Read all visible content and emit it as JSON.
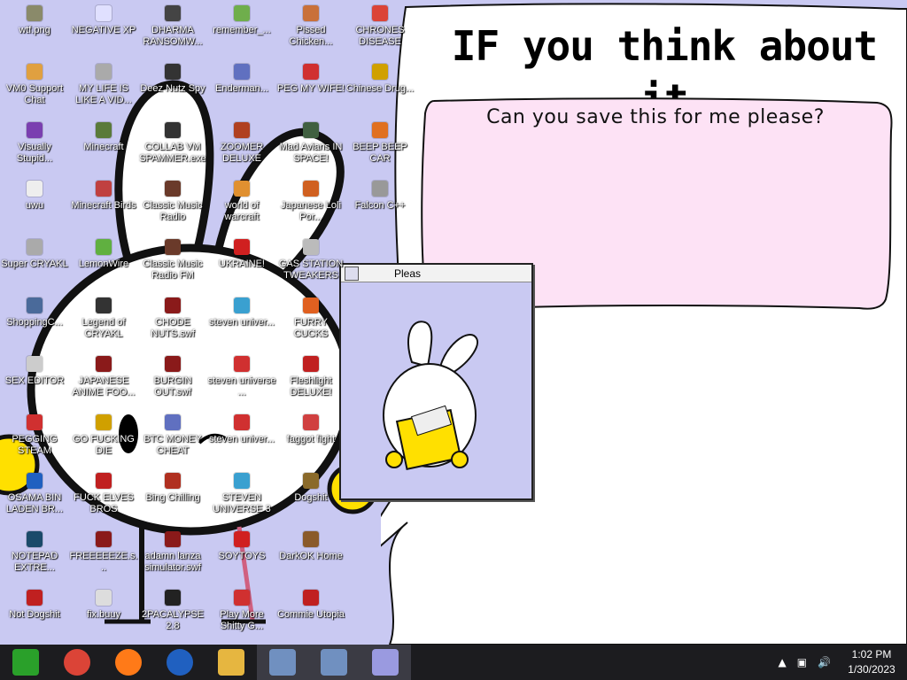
{
  "speech_bubble": {
    "heading": "IF you think about it",
    "prompt": "Can you save this for me please?"
  },
  "app_window": {
    "title": "Pleas"
  },
  "desktop_icons": [
    {
      "label": "wtf.png",
      "icon": "image-file-icon",
      "color": "#8a8a6a"
    },
    {
      "label": "NEGATIVE XP",
      "icon": "bunny-icon",
      "color": "#e0e0ff"
    },
    {
      "label": "DHARMA RANSOMW...",
      "icon": "gear-icon",
      "color": "#444"
    },
    {
      "label": "remember_...",
      "icon": "folder-icon",
      "color": "#6fae4c"
    },
    {
      "label": "Pissed Chicken...",
      "icon": "chicken-icon",
      "color": "#c9703a"
    },
    {
      "label": "CHRONES DISEASE",
      "icon": "chrome-icon",
      "color": "#db4437"
    },
    {
      "label": "VM0 Support Chat",
      "icon": "person-icon",
      "color": "#e0a040"
    },
    {
      "label": "MY LIFE IS LIKE A VID...",
      "icon": "controller-icon",
      "color": "#aaa"
    },
    {
      "label": "Deez Nutz Spy",
      "icon": "spy-icon",
      "color": "#333"
    },
    {
      "label": "Enderman...",
      "icon": "diamond-icon",
      "color": "#6070c0"
    },
    {
      "label": "PEG MY WIFE!",
      "icon": "peg-icon",
      "color": "#d03030"
    },
    {
      "label": "Chinese Drug...",
      "icon": "drug-icon",
      "color": "#d0a000"
    },
    {
      "label": "Visually Stupid...",
      "icon": "visual-studio-icon",
      "color": "#7a3fb0"
    },
    {
      "label": "Minecraft",
      "icon": "grass-block-icon",
      "color": "#5a7a3a"
    },
    {
      "label": "COLLAB VM SPAMMER.exe",
      "icon": "vm-icon",
      "color": "#333"
    },
    {
      "label": "ZOOMER DELUXE",
      "icon": "zoomer-icon",
      "color": "#b04020"
    },
    {
      "label": "Mad Avians IN SPACE!",
      "icon": "bird-icon",
      "color": "#406040"
    },
    {
      "label": "BEEP BEEP CAR",
      "icon": "cone-icon",
      "color": "#e07020"
    },
    {
      "label": "uwu",
      "icon": "text-file-icon",
      "color": "#eee"
    },
    {
      "label": "Minecraft Birds",
      "icon": "bird-icon",
      "color": "#c04040"
    },
    {
      "label": "Classic Music Radio",
      "icon": "singer-icon",
      "color": "#6a3a2a"
    },
    {
      "label": "world of warcraft",
      "icon": "warcraft-icon",
      "color": "#e09030"
    },
    {
      "label": "Japanese Loli Por...",
      "icon": "gate-icon",
      "color": "#d06020"
    },
    {
      "label": "Falcon C++",
      "icon": "trash-icon",
      "color": "#999"
    },
    {
      "label": "Super CRYAKL",
      "icon": "cat-icon",
      "color": "#aaa"
    },
    {
      "label": "LemonWire",
      "icon": "lemon-icon",
      "color": "#60b040"
    },
    {
      "label": "Classic Music Radio FM",
      "icon": "singer-icon",
      "color": "#6a3a2a"
    },
    {
      "label": "UKRAINE!",
      "icon": "radiation-icon",
      "color": "#d02020"
    },
    {
      "label": "GAS STATION TWEAKERS",
      "icon": "fan-icon",
      "color": "#bbb"
    },
    {
      "label": "ShoppingC...",
      "icon": "compass-icon",
      "color": "#4a6a9a"
    },
    {
      "label": "Legend of CRYAKL",
      "icon": "fighter-icon",
      "color": "#333"
    },
    {
      "label": "CHODE NUTS.swf",
      "icon": "flash-icon",
      "color": "#8a1a1a"
    },
    {
      "label": "steven univer...",
      "icon": "gem-icon",
      "color": "#3aa0d0"
    },
    {
      "label": "FURRY CUCKS",
      "icon": "firefox-icon",
      "color": "#e06020"
    },
    {
      "label": "SEX EDITOR",
      "icon": "hex-editor-icon",
      "color": "#ccc"
    },
    {
      "label": "JAPANESE ANIME FOO...",
      "icon": "flash-icon",
      "color": "#8a1a1a"
    },
    {
      "label": "BURGIN OUT.swf",
      "icon": "flash-icon",
      "color": "#8a1a1a"
    },
    {
      "label": "steven universe ...",
      "icon": "steven-icon",
      "color": "#d03030"
    },
    {
      "label": "Fleshlight DELUXE!",
      "icon": "flashlight-icon",
      "color": "#c02020"
    },
    {
      "label": "PEGGING STEAM",
      "icon": "peg-icon",
      "color": "#d03030"
    },
    {
      "label": "GO FUCKING DIE",
      "icon": "de-icon",
      "color": "#d0a000"
    },
    {
      "label": "BTC MONEY CHEAT",
      "icon": "diamond-icon",
      "color": "#6070c0"
    },
    {
      "label": "steven univer...",
      "icon": "steven-icon",
      "color": "#d03030"
    },
    {
      "label": "faggot fight",
      "icon": "fighter-icon",
      "color": "#d04040"
    },
    {
      "label": "OSAMA BIN LADEN BR...",
      "icon": "obama-icon",
      "color": "#2060c0"
    },
    {
      "label": "FUCK ELVES BROS",
      "icon": "elf-icon",
      "color": "#c02020"
    },
    {
      "label": "Bing Chilling",
      "icon": "bing-icon",
      "color": "#b03020"
    },
    {
      "label": "STEVEN UNIVERSE 3",
      "icon": "gem-icon",
      "color": "#3aa0d0"
    },
    {
      "label": "Dogshit",
      "icon": "dog-icon",
      "color": "#8a6a2a"
    },
    {
      "label": "NOTEPAD EXTRE...",
      "icon": "notepad-icon",
      "color": "#1a4a6a"
    },
    {
      "label": "FREEEEEZE.s...",
      "icon": "flash-icon",
      "color": "#8a1a1a"
    },
    {
      "label": "adamn lanza simulator.swf",
      "icon": "flash-icon",
      "color": "#8a1a1a"
    },
    {
      "label": "SOYTOYS",
      "icon": "s-logo-icon",
      "color": "#d02020"
    },
    {
      "label": "DarkOK Home",
      "icon": "poop-icon",
      "color": "#8a5a2a"
    },
    {
      "label": "Not Dogshit",
      "icon": "devcpp-icon",
      "color": "#c02020"
    },
    {
      "label": "fix.buuy",
      "icon": "script-file-icon",
      "color": "#ddd"
    },
    {
      "label": "2PACALYPSE 2.8",
      "icon": "console-icon",
      "color": "#222"
    },
    {
      "label": "Play More Shitty G...",
      "icon": "play-icon",
      "color": "#d03030"
    },
    {
      "label": "Commie Utopia",
      "icon": "commie-icon",
      "color": "#c02020"
    }
  ],
  "taskbar": {
    "apps": [
      {
        "name": "start-logo",
        "color": "#2aa02a"
      },
      {
        "name": "chrome",
        "color": "#db4437"
      },
      {
        "name": "firefox",
        "color": "#ff7a18"
      },
      {
        "name": "obama",
        "color": "#2060c0"
      },
      {
        "name": "file-explorer",
        "color": "#e6b640"
      },
      {
        "name": "installer",
        "color": "#7090c0"
      },
      {
        "name": "installer-2",
        "color": "#7090c0"
      },
      {
        "name": "bunny-app",
        "color": "#9a9ae0"
      }
    ],
    "time": "1:02 PM",
    "date": "1/30/2023"
  }
}
